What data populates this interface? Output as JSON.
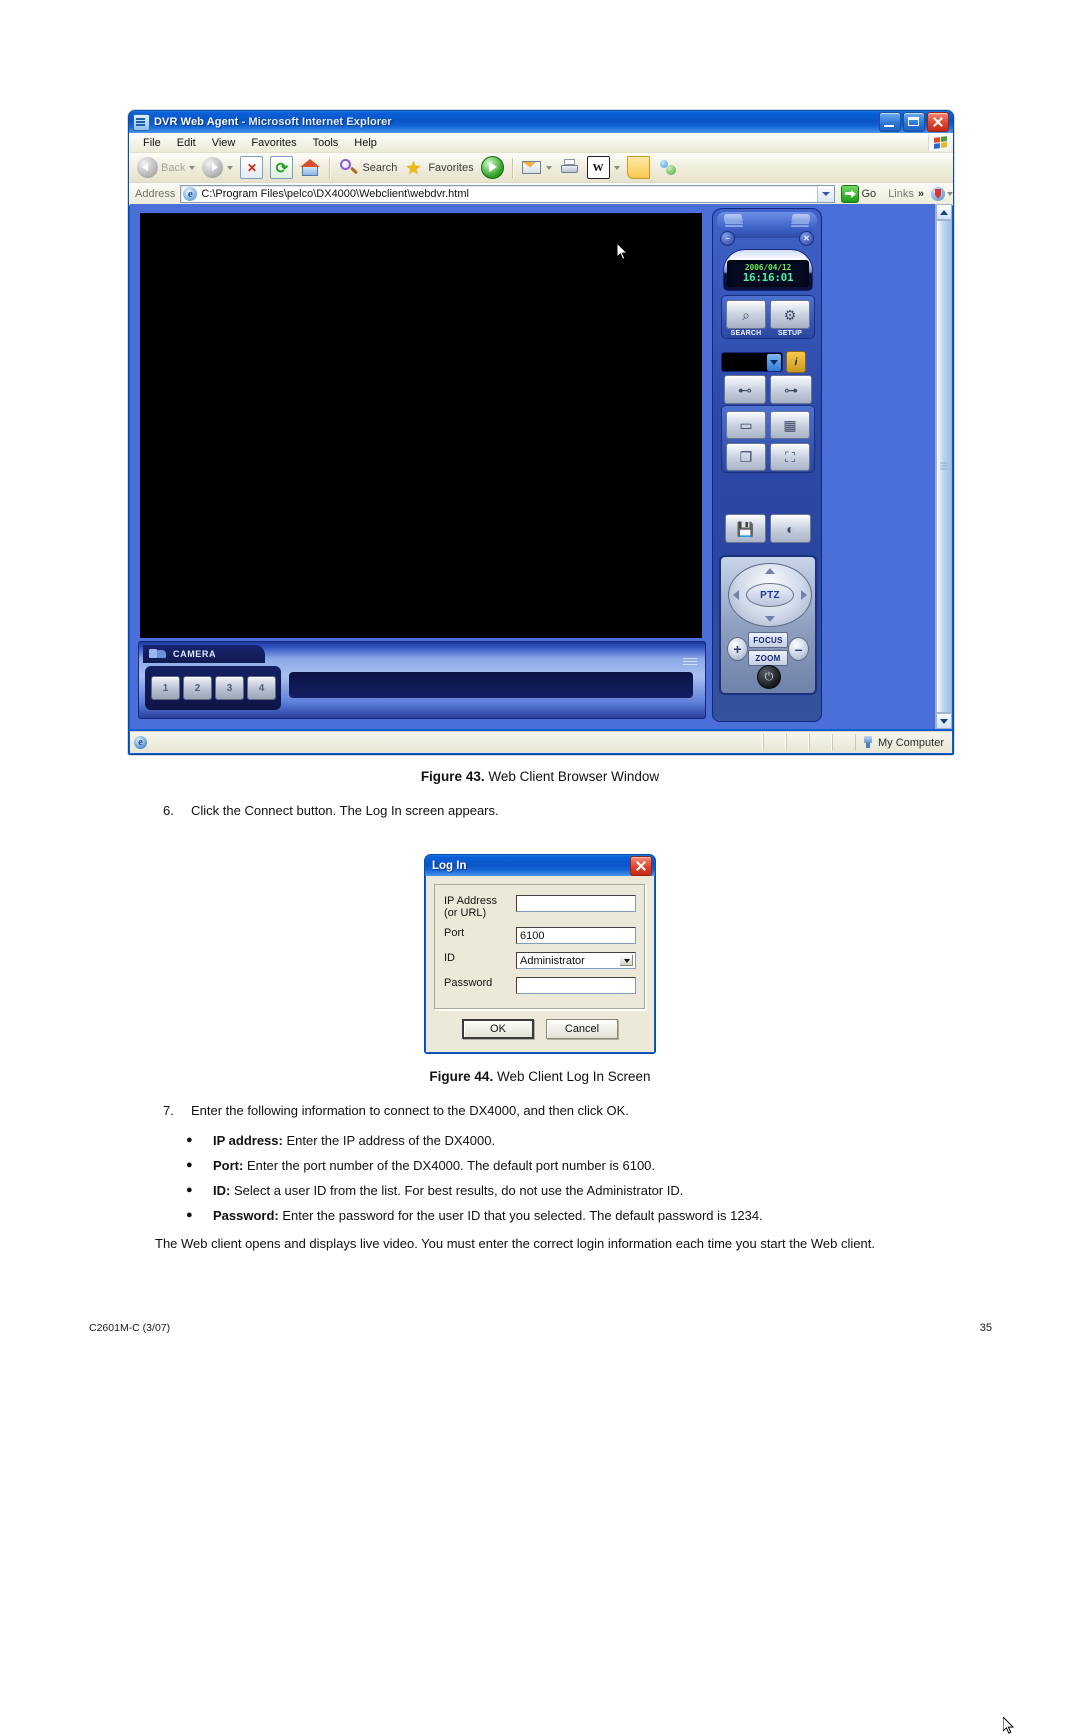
{
  "browser": {
    "title_app": "DVR Web Agent",
    "title_suffix": " - Microsoft Internet Explorer",
    "menus": [
      "File",
      "Edit",
      "View",
      "Favorites",
      "Tools",
      "Help"
    ],
    "toolbar": {
      "back_label": "Back",
      "search_label": "Search",
      "favorites_label": "Favorites"
    },
    "address": {
      "label": "Address",
      "value": "C:\\Program Files\\pelco\\DX4000\\Webclient\\webdvr.html",
      "go_label": "Go",
      "links_label": "Links",
      "chevron": "»"
    },
    "window_buttons": {
      "minimize": "Minimize",
      "maximize": "Maximize",
      "close": "Close"
    },
    "statusbar": {
      "zone": "My Computer"
    }
  },
  "dvr_app": {
    "lcd": {
      "date": "2006/04/12",
      "time": "16:16:01"
    },
    "panel_buttons": {
      "search_label": "SEARCH",
      "setup_label": "SETUP",
      "minimize": "–",
      "close": "✕",
      "info": "i"
    },
    "layout_buttons": [
      "single-view",
      "quad-view",
      "cascade-view",
      "fullscreen-view"
    ],
    "tool_buttons": [
      "save-snapshot",
      "brightness"
    ],
    "ptz": {
      "center_label": "PTZ",
      "focus_label": "FOCUS",
      "zoom_label": "ZOOM",
      "plus": "+",
      "minus": "–",
      "power": "⏻"
    },
    "camera_bar": {
      "tab_label": "CAMERA",
      "buttons": [
        "1",
        "2",
        "3",
        "4"
      ]
    }
  },
  "login_dialog": {
    "title": "Log In",
    "fields": [
      {
        "label_line1": "IP Address",
        "label_line2": "(or URL)",
        "value": "",
        "type": "text"
      },
      {
        "label_line1": "Port",
        "label_line2": "",
        "value": "6100",
        "type": "text"
      },
      {
        "label_line1": "ID",
        "label_line2": "",
        "value": "Administrator",
        "type": "select"
      },
      {
        "label_line1": "Password",
        "label_line2": "",
        "value": "",
        "type": "password"
      }
    ],
    "ok_label": "OK",
    "cancel_label": "Cancel"
  },
  "document": {
    "figure43": {
      "number": "Figure 43.",
      "caption": "Web Client Browser Window"
    },
    "figure44": {
      "number": "Figure 44.",
      "caption": "Web Client Log In Screen"
    },
    "step6": {
      "number": "6.",
      "text": "Click the Connect button. The Log In screen appears."
    },
    "step7": {
      "number": "7.",
      "text": "Enter the following information to connect to the DX4000, and then click OK."
    },
    "bullets": [
      {
        "term": "IP address:",
        "text": " Enter the IP address of the DX4000."
      },
      {
        "term": "Port:",
        "text": " Enter the port number of the DX4000. The default port number is 6100."
      },
      {
        "term": "ID:",
        "text": " Select a user ID from the list. For best results, do not use the Administrator ID."
      },
      {
        "term": "Password:",
        "text": " Enter the password for the user ID that you selected. The default password is 1234."
      }
    ],
    "closing": "The Web client opens and displays live video. You must enter the correct login information each time you start the Web client.",
    "footer_left": "C2601M-C (3/07)",
    "footer_right": "35"
  }
}
